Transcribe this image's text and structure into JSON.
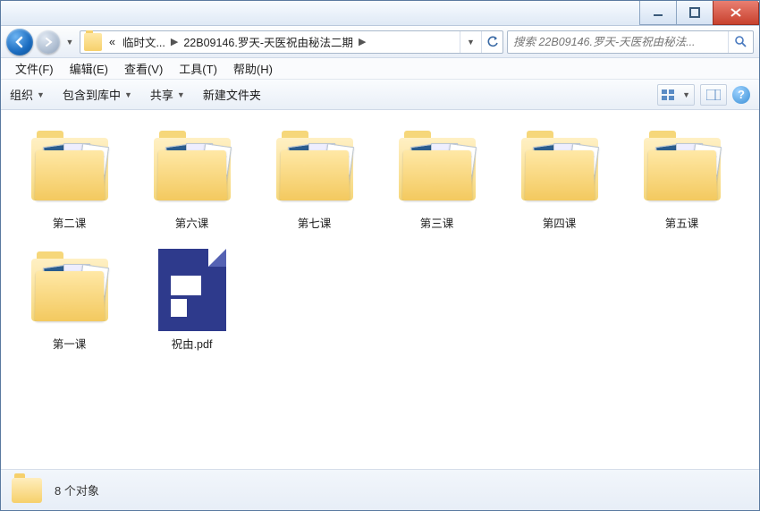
{
  "titlebar": {},
  "nav": {
    "crumb_prefix": "«",
    "crumb1": "临时文...",
    "crumb2": "22B09146.罗天-天医祝由秘法二期",
    "search_placeholder": "搜索 22B09146.罗天-天医祝由秘法..."
  },
  "menu": {
    "file": "文件(F)",
    "edit": "编辑(E)",
    "view": "查看(V)",
    "tools": "工具(T)",
    "help": "帮助(H)"
  },
  "toolbar": {
    "organize": "组织",
    "include": "包含到库中",
    "share": "共享",
    "newfolder": "新建文件夹"
  },
  "items": [
    {
      "label": "第二课",
      "type": "folder"
    },
    {
      "label": "第六课",
      "type": "folder"
    },
    {
      "label": "第七课",
      "type": "folder"
    },
    {
      "label": "第三课",
      "type": "folder"
    },
    {
      "label": "第四课",
      "type": "folder"
    },
    {
      "label": "第五课",
      "type": "folder"
    },
    {
      "label": "第一课",
      "type": "folder"
    },
    {
      "label": "祝由.pdf",
      "type": "pdf"
    }
  ],
  "status": {
    "text": "8 个对象"
  }
}
